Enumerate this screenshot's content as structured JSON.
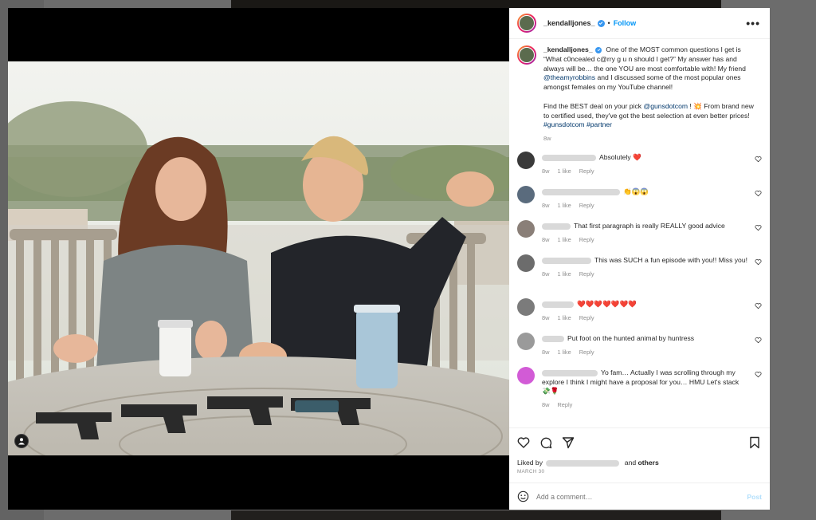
{
  "post": {
    "username": "_kendalljones_",
    "follow_label": "Follow",
    "dot": "•",
    "more_label": "•••",
    "caption": {
      "p1_a": "One of the MOST common questions I get is “What c0ncealed c@rry g u n should I get?” My answer has and always will be… the one YOU are most comfortable with! My friend ",
      "mention1": "@theamyrobbins",
      "p1_b": " and I discussed some of the most popular ones amongst females on my YouTube channel!",
      "p2_a": "Find the BEST deal on your pick ",
      "mention2": "@gunsdotcom",
      "p2_b": " ! 💥 From brand new to certified used, they've got the best selection at even better prices! ",
      "tag1": "#gunsdotcom",
      "tag2": "#partner",
      "time": "8w"
    },
    "comments": [
      {
        "text": "Absolutely ❤️",
        "time": "8w",
        "likes": "1 like",
        "reply": "Reply",
        "avatar": "#3a3a3a"
      },
      {
        "text": "👏😱😱",
        "time": "8w",
        "likes": "1 like",
        "reply": "Reply",
        "avatar": "#5a6b7d"
      },
      {
        "text": "That first paragraph is really REALLY good advice",
        "time": "8w",
        "likes": "1 like",
        "reply": "Reply",
        "avatar": "#8a7f78"
      },
      {
        "text": "This was SUCH a fun episode with you!! Miss you!",
        "time": "8w",
        "likes": "1 like",
        "reply": "Reply",
        "avatar": "#6c6c6c"
      },
      {
        "text": "❤️❤️❤️❤️❤️❤️❤️",
        "time": "8w",
        "likes": "1 like",
        "reply": "Reply",
        "avatar": "#7b7b7b"
      },
      {
        "text": "Put foot on the hunted animal by huntress",
        "time": "8w",
        "likes": "1 like",
        "reply": "Reply",
        "avatar": "#9a9a9a"
      },
      {
        "text": "Yo fam… Actually I was scrolling through my explore I think I might have a proposal for you… HMU Let's stack 💸🌹",
        "time": "8w",
        "likes": "",
        "reply": "Reply",
        "avatar": "#d25bd6"
      }
    ],
    "liked_by_prefix": "Liked by",
    "and_label": "and",
    "others_label": "others",
    "date": "MARCH 30",
    "add_comment_placeholder": "Add a comment…",
    "post_label": "Post"
  },
  "colors": {
    "accent": "#0095f6",
    "heart": "#ed4956"
  }
}
